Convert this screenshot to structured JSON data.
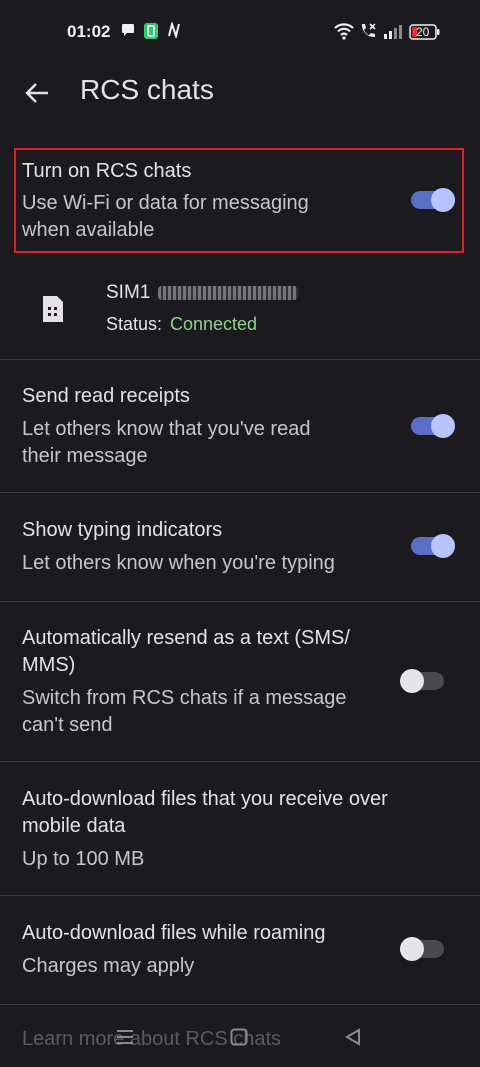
{
  "status_bar": {
    "time": "01:02",
    "battery": "20"
  },
  "app_bar": {
    "title": "RCS chats"
  },
  "settings": {
    "rcs": {
      "title": "Turn on RCS chats",
      "subtitle_line1": "Use Wi-Fi or data for messaging",
      "subtitle_line2": "when available",
      "enabled": true
    },
    "sim": {
      "name": "SIM1",
      "status_label": "Status: ",
      "status_value": "Connected",
      "status_color": "#8fd18b"
    },
    "read_receipts": {
      "title": "Send read receipts",
      "subtitle_line1": "Let others know that you've read",
      "subtitle_line2": "their message",
      "enabled": true
    },
    "typing": {
      "title": "Show typing indicators",
      "subtitle_line1": "Let others know when you're typing",
      "enabled": true
    },
    "resend": {
      "title_line1": "Automatically resend as a text (SMS/",
      "title_line2": "MMS)",
      "subtitle_line1": "Switch from RCS chats if a message",
      "subtitle_line2": "can't send",
      "enabled": false
    },
    "auto_download": {
      "title_line1": "Auto-download files that you receive over",
      "title_line2": "mobile data",
      "subtitle_line1": "Up to 100 MB"
    },
    "roaming": {
      "title": "Auto-download files while roaming",
      "subtitle_line1": "Charges may apply",
      "enabled": false
    },
    "learn_more": "Learn more about RCS chats"
  },
  "colors": {
    "accent": "#b8c4ff",
    "highlight": "#e0202a",
    "background": "#1b1b1f"
  },
  "icons": [
    "back-arrow-icon",
    "sim-card-icon",
    "wifi-icon",
    "call-icon",
    "signal-icon",
    "battery-icon",
    "menu-icon",
    "home-icon",
    "back-icon"
  ]
}
